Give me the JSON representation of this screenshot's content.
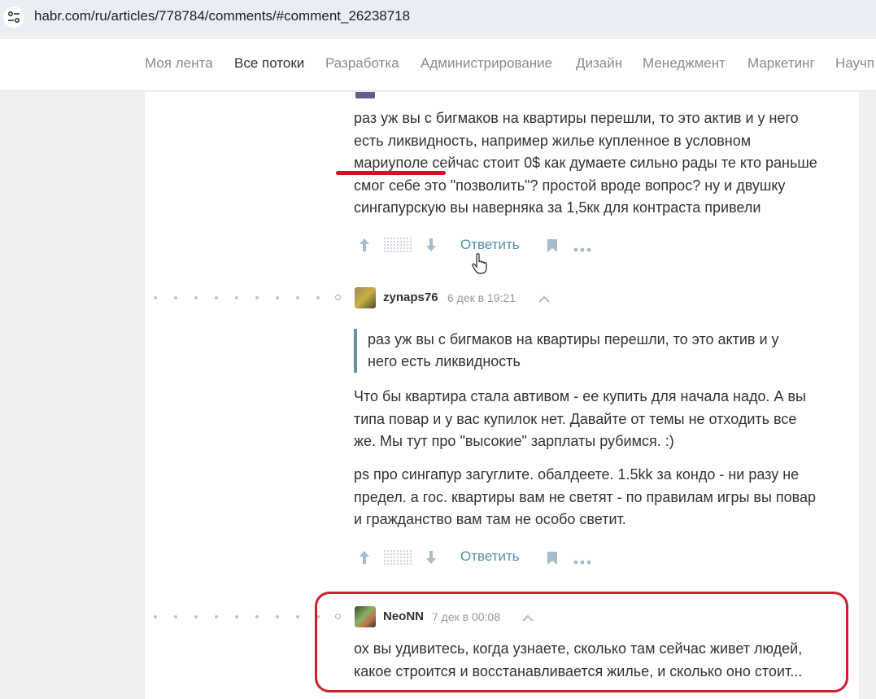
{
  "browser": {
    "url": "habr.com/ru/articles/778784/comments/#comment_26238718",
    "site_icon": "tune-icon"
  },
  "nav": {
    "items": [
      {
        "label": "Моя лента",
        "active": false
      },
      {
        "label": "Все потоки",
        "active": true
      },
      {
        "label": "Разработка",
        "active": false
      },
      {
        "label": "Администрирование",
        "active": false
      },
      {
        "label": "Дизайн",
        "active": false
      },
      {
        "label": "Менеджмент",
        "active": false
      },
      {
        "label": "Маркетинг",
        "active": false
      },
      {
        "label": "Научп",
        "active": false
      }
    ]
  },
  "comments": [
    {
      "body_lines": [
        "раз уж вы с бигмаков на квартиры перешли, то это актив и у него",
        "есть ликвидность, например жилье купленное в условном",
        "мариуполе сейчас стоит 0$ как думаете сильно рады те кто раньше",
        "смог себе это \"позволить\"? простой вроде вопрос? ну и двушку",
        "сингапурскую вы наверняка за 1,5кк для контраста привели"
      ],
      "reply_label": "Ответить"
    },
    {
      "username": "zynaps76",
      "date": "6 дек в 19:21",
      "quote_lines": [
        "раз уж вы с бигмаков на квартиры перешли, то это актив и у",
        "него есть ликвидность"
      ],
      "paragraph1_lines": [
        "Что бы квартира стала автивом - ее купить для начала надо. А вы",
        "типа повар и у вас купилок нет. Давайте от темы не отходить все",
        "же. Мы тут про \"высокие\" зарплаты рубимся. :)"
      ],
      "paragraph2_lines": [
        "ps про сингапур загуглите. обалдеете. 1.5kk за кондо - ни разу не",
        "предел. а гос. квартиры вам не светят - по правилам игры вы повар",
        "и гражданство вам там не особо светит."
      ],
      "reply_label": "Ответить"
    },
    {
      "username": "NeoNN",
      "date": "7 дек в 00:08",
      "body_lines": [
        "ох вы удивитесь, когда узнаете, сколько там сейчас живет людей,",
        "какое строится и восстанавливается жилье, и сколько оно стоит..."
      ]
    }
  ],
  "colors": {
    "accent_link": "#548eaa",
    "annotation_red": "#d01f2a",
    "icon_gray": "#8aa6bd"
  },
  "icons": [
    "arrow-up-icon",
    "arrow-down-icon",
    "bookmark-icon",
    "more-icon",
    "collapse-chevron-icon",
    "pointer-cursor-icon"
  ]
}
